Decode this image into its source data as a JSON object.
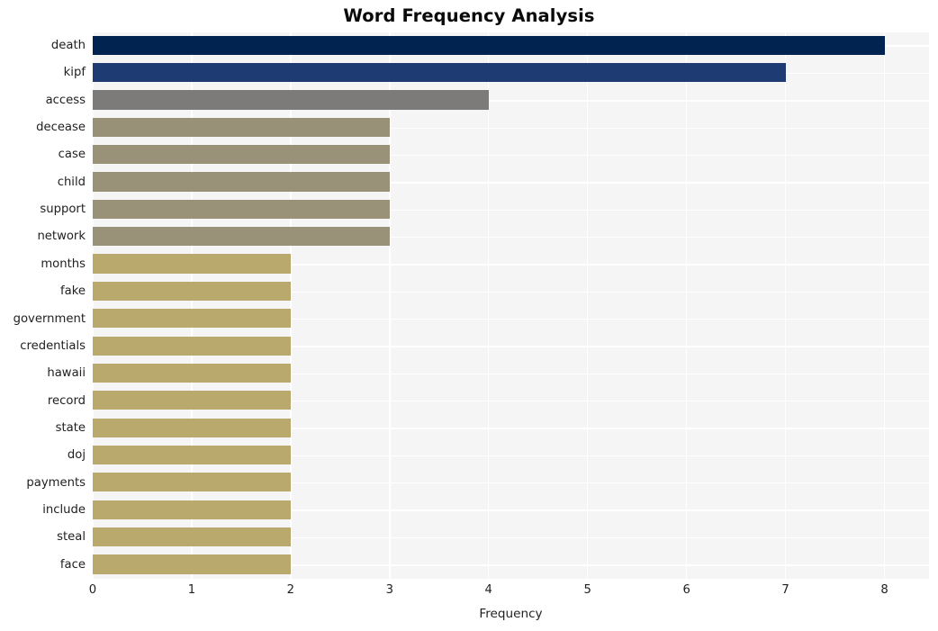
{
  "chart_data": {
    "type": "bar",
    "orientation": "horizontal",
    "title": "Word Frequency Analysis",
    "xlabel": "Frequency",
    "ylabel": "",
    "xlim": [
      0,
      8.45
    ],
    "xticks": [
      0,
      1,
      2,
      3,
      4,
      5,
      6,
      7,
      8
    ],
    "xtick_labels": [
      "0",
      "1",
      "2",
      "3",
      "4",
      "5",
      "6",
      "7",
      "8"
    ],
    "grid": true,
    "legend": false,
    "categories": [
      "death",
      "kipf",
      "access",
      "decease",
      "case",
      "child",
      "support",
      "network",
      "months",
      "fake",
      "government",
      "credentials",
      "hawaii",
      "record",
      "state",
      "doj",
      "payments",
      "include",
      "steal",
      "face"
    ],
    "values": [
      8,
      7,
      4,
      3,
      3,
      3,
      3,
      3,
      2,
      2,
      2,
      2,
      2,
      2,
      2,
      2,
      2,
      2,
      2,
      2
    ],
    "bar_colors": [
      "#012350",
      "#1e3b73",
      "#7c7b79",
      "#999177",
      "#999178",
      "#999178",
      "#999178",
      "#999178",
      "#b9a96c",
      "#b9a96c",
      "#b9a96c",
      "#b9a96c",
      "#b9a96c",
      "#b9a96c",
      "#b9a96c",
      "#b9a96c",
      "#b9a96c",
      "#b9a96c",
      "#b9a96c",
      "#b9a96c"
    ],
    "plot_background": "#f5f5f5",
    "grid_color": "#ffffff",
    "figure_background": "#ffffff",
    "text_color": "#1f1f1f"
  }
}
